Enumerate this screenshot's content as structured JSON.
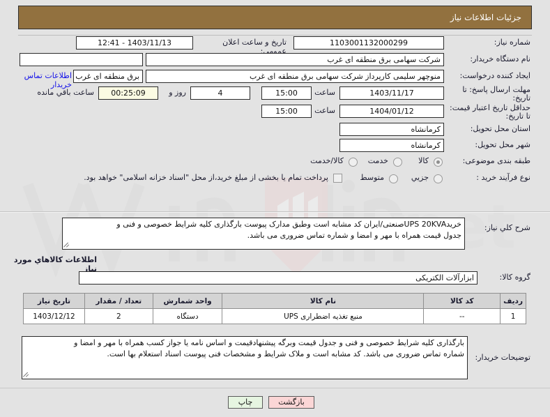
{
  "header": {
    "title": "جزئیات اطلاعات نیاز"
  },
  "fields": {
    "need_number_label": "شماره نیاز:",
    "need_number_value": "1103001132000299",
    "announce_label": "تاریخ و ساعت اعلان عمومی:",
    "announce_value": "1403/11/13 - 12:41",
    "buyer_org_label": "نام دستگاه خریدار:",
    "buyer_org_value": "شرکت سهامی برق منطقه ای غرب",
    "buyer_org_value2": "",
    "creator_label": "ایجاد کننده درخواست:",
    "creator_value": "منوچهر سلیمی کارپرداز شرکت سهامی برق منطقه ای غرب",
    "creator_value2": "برق منطقه ای غرب",
    "contact_link": "اطلاعات تماس خریدار",
    "deadline_label": "مهلت ارسال پاسخ: تا تاریخ:",
    "deadline_date": "1403/11/17",
    "hour_label": "ساعت",
    "deadline_hour": "15:00",
    "days_value": "4",
    "days_label": "روز و",
    "countdown_value": "00:25:09",
    "countdown_label": "ساعت باقي مانده",
    "valid_label": "حداقل تاریخ اعتبار قیمت: تا تاریخ:",
    "valid_date": "1404/01/12",
    "valid_hour": "15:00",
    "province_label": "استان محل تحویل:",
    "province_value": "کرمانشاه",
    "city_label": "شهر محل تحویل:",
    "city_value": "کرمانشاه",
    "category_label": "طبقه بندی موضوعی:",
    "category_options": [
      {
        "label": "کالا",
        "selected": true
      },
      {
        "label": "خدمت",
        "selected": false
      },
      {
        "label": "کالا/خدمت",
        "selected": false
      }
    ],
    "process_label": "نوع فرآیند خرید :",
    "process_options": [
      {
        "label": "جزیي",
        "selected": false
      },
      {
        "label": "متوسط",
        "selected": false
      }
    ],
    "treasury_note": "پرداخت تمام یا بخشی از مبلغ خرید،از محل \"اسناد خزانه اسلامی\" خواهد بود."
  },
  "description": {
    "label": "شرح کلي نیاز:",
    "line1": "خریدUPS 20KVAصنعتی/ایران کد مشابه است وطبق مدارک پیوست بارگذاری کلیه شرایط خصوصی و فنی و",
    "line2": "جدول قیمت همراه با مهر و امضا و شماره تماس ضروری می باشد."
  },
  "goods_section": {
    "title": "اطلاعات کالاهاي مورد نیاز",
    "group_label": "گروه کالا:",
    "group_value": "ابزارآلات الکتریکی",
    "columns": [
      "ردیف",
      "کد کالا",
      "نام کالا",
      "واحد شمارش",
      "تعداد / مقدار",
      "تاریخ نیاز"
    ],
    "rows": [
      {
        "radif": "1",
        "code": "--",
        "name": "منبع تغذیه اضطراری UPS",
        "unit": "دستگاه",
        "qty": "2",
        "date": "1403/12/12"
      }
    ]
  },
  "buyer_notes": {
    "label": "توضیحات خریدار:",
    "line1": "بارگذاری کلیه شرایط خصوصی و فنی و جدول قیمت وبرگه پیشنهادقیمت و اساس نامه یا جواز کسب همراه با مهر و امضا و",
    "line2": "شماره تماس ضروری می باشد. کد مشابه است و ملاک شرایط و مشخصات فنی پیوست اسناد استعلام بها است."
  },
  "buttons": {
    "back": "بازگشت",
    "print": "چاپ"
  },
  "colors": {
    "header_bg": "#92713f",
    "link": "#1310e8",
    "back_btn": "#fbd6d6",
    "print_btn": "#e6f5e1",
    "countdown_bg": "#fbfbe3",
    "table_header": "#d4d4d4"
  },
  "watermark": {
    "text": "iTenderN"
  }
}
